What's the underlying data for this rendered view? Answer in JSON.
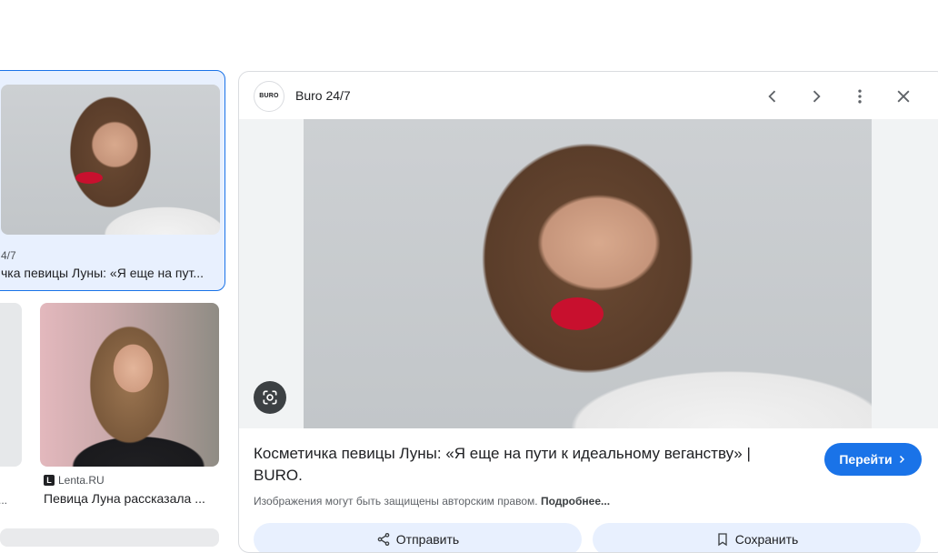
{
  "grid": {
    "selected_card": {
      "source": "4/7",
      "title": "чка певицы Луны: «Я еще на пут..."
    },
    "left_partial_card": {
      "source_partial": "...",
      "title_partial": "..."
    },
    "lenta_card": {
      "favicon_letter": "L",
      "source": "Lenta.RU",
      "title": "Певица Луна рассказала ..."
    }
  },
  "preview": {
    "source_logo_text": "BURO",
    "source_name": "Buro 24/7",
    "headline": "Косметичка певицы Луны: «Я еще на пути к идеальному веганству» | BURO.",
    "visit_button": "Перейти",
    "copyright_text": "Изображения могут быть защищены авторским правом.",
    "copyright_link": "Подробнее...",
    "share_label": "Отправить",
    "save_label": "Сохранить"
  },
  "icons": {
    "prev": "chevron-left-icon",
    "next": "chevron-right-icon",
    "more": "more-vert-icon",
    "close": "close-icon",
    "lens": "google-lens-icon",
    "share": "share-icon",
    "save": "bookmark-icon"
  },
  "colors": {
    "accent": "#1a73e8",
    "selected_bg": "#e8f0fe",
    "lips": "#c8102e"
  }
}
